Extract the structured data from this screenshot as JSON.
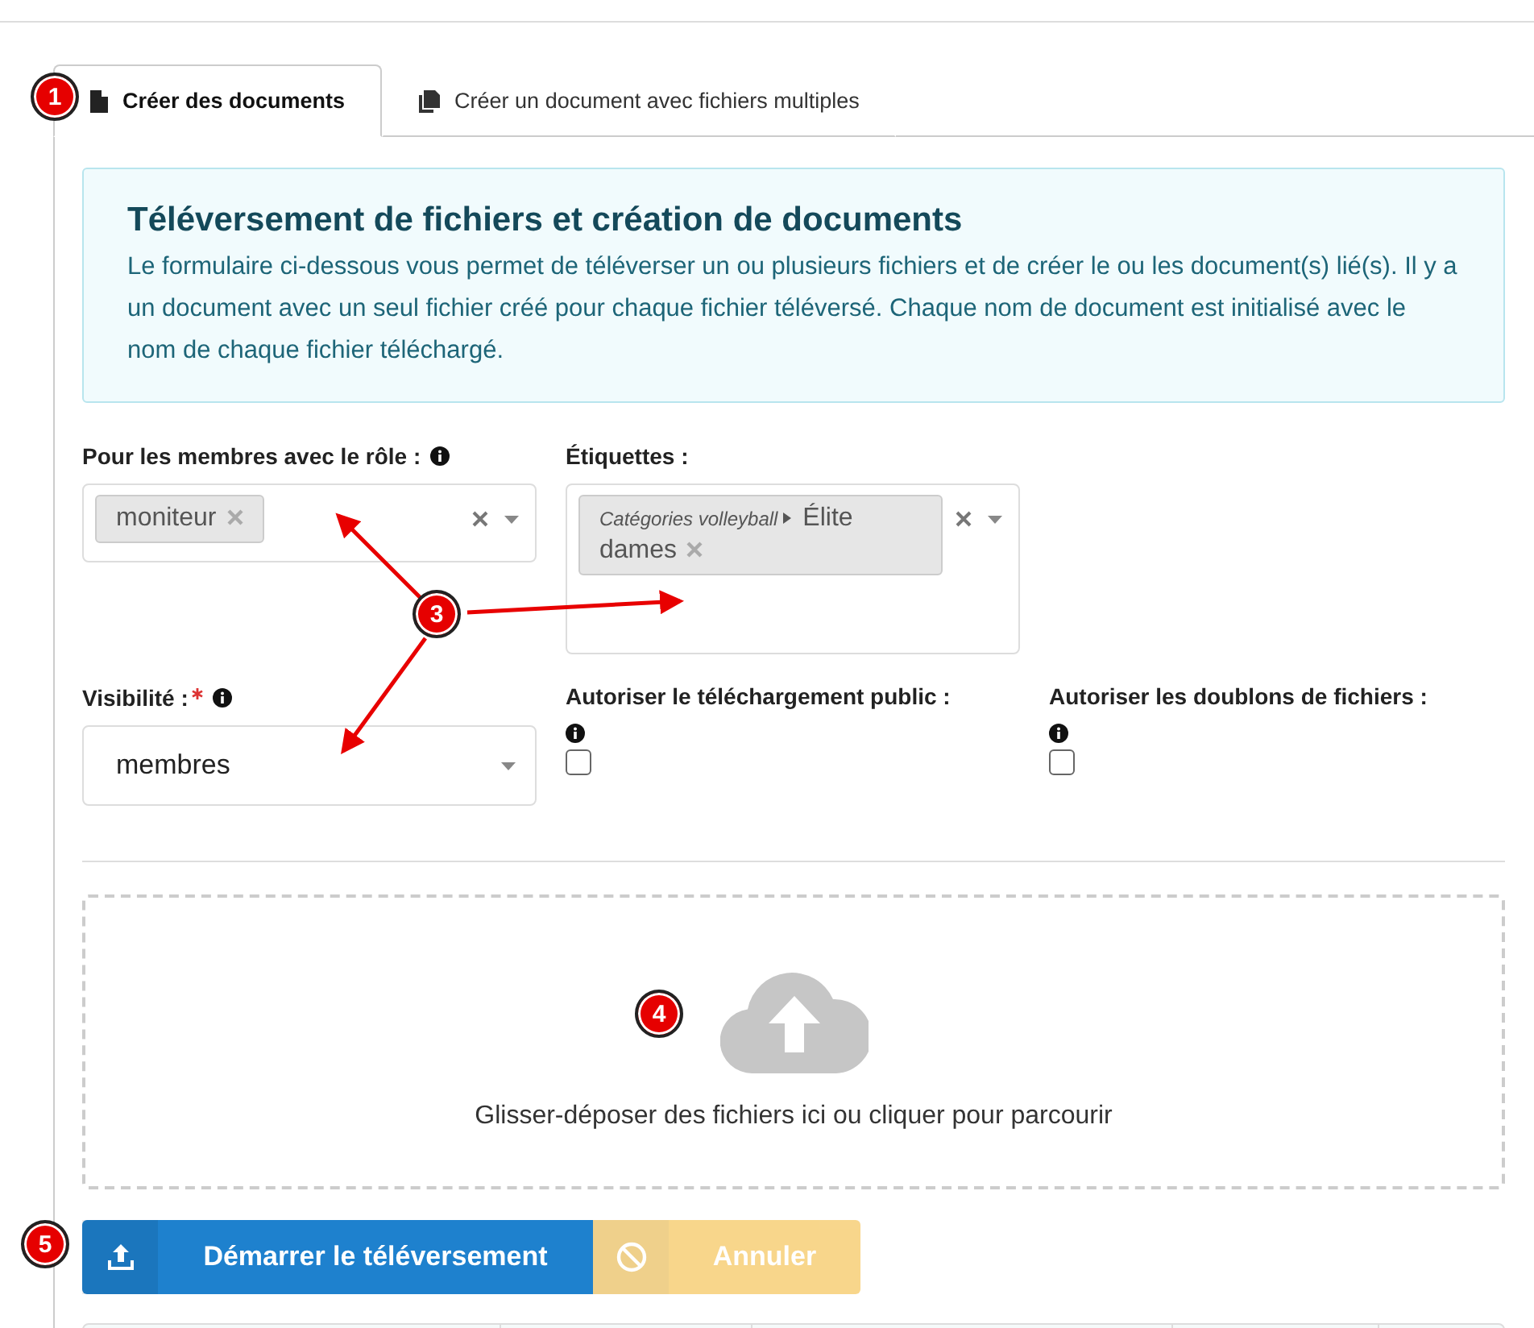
{
  "tabs": [
    {
      "label": "Créer des documents",
      "selected": true
    },
    {
      "label": "Créer un document avec fichiers multiples",
      "selected": false
    }
  ],
  "info": {
    "title": "Téléversement de fichiers et création de documents",
    "text": "Le formulaire ci-dessous vous permet de téléverser un ou plusieurs fichiers et de créer le ou les document(s) lié(s). Il y a un document avec un seul fichier créé pour chaque fichier téléversé. Chaque nom de document est initialisé avec le nom de chaque fichier téléchargé."
  },
  "fields": [
    {
      "kind": "multiselect",
      "label": "Pour les membres avec le rôle :",
      "required": false,
      "info": true,
      "tags": [
        {
          "text": "moniteur"
        }
      ]
    },
    {
      "kind": "multiselect",
      "label": "Étiquettes :",
      "required": false,
      "info": false,
      "tags": [
        {
          "path": "Catégories volleyball",
          "text": "Élite dames"
        }
      ]
    },
    {
      "kind": "select",
      "label": "Visibilité :",
      "required": true,
      "info": true,
      "value": "membres"
    },
    {
      "kind": "checkbox",
      "label": "Autoriser le téléchargement public :",
      "info": true,
      "checked": false
    },
    {
      "kind": "checkbox",
      "label": "Autoriser les doublons de fichiers :",
      "info": true,
      "checked": false
    }
  ],
  "dropzone": {
    "text": "Glisser-déposer des fichiers ici ou cliquer pour parcourir"
  },
  "buttons": [
    {
      "label": "Démarrer le téléversement",
      "kind": "primary",
      "disabled": false
    },
    {
      "label": "Annuler",
      "kind": "warning",
      "disabled": true
    }
  ],
  "markers": [
    {
      "number": "1"
    },
    {
      "number": "3"
    },
    {
      "number": "4"
    },
    {
      "number": "5"
    }
  ]
}
